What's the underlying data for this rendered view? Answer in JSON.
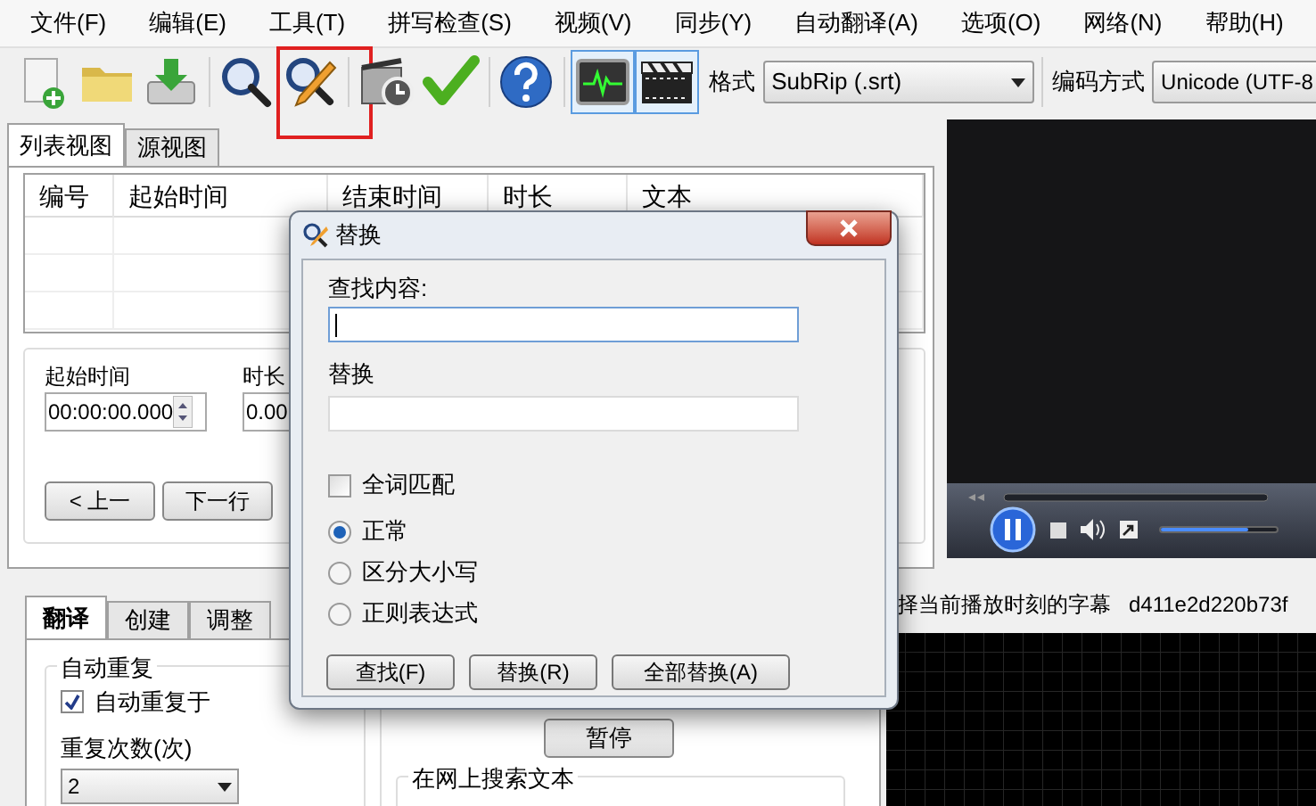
{
  "menu": [
    "文件(F)",
    "编辑(E)",
    "工具(T)",
    "拼写检查(S)",
    "视频(V)",
    "同步(Y)",
    "自动翻译(A)",
    "选项(O)",
    "网络(N)",
    "帮助(H)"
  ],
  "toolbar": {
    "buttons": [
      {
        "kind": "new",
        "selected": false,
        "highlighted": false
      },
      {
        "kind": "open",
        "selected": false,
        "highlighted": false
      },
      {
        "kind": "save",
        "selected": false,
        "highlighted": false
      },
      {
        "kind": "find",
        "selected": false,
        "highlighted": false
      },
      {
        "kind": "replace",
        "selected": false,
        "highlighted": true
      },
      {
        "kind": "timing",
        "selected": false,
        "highlighted": false
      },
      {
        "kind": "check",
        "selected": false,
        "highlighted": false
      },
      {
        "kind": "help",
        "selected": false,
        "highlighted": false
      },
      {
        "kind": "waveform",
        "selected": true,
        "highlighted": false
      },
      {
        "kind": "video",
        "selected": true,
        "highlighted": false
      }
    ],
    "format": {
      "label": "格式",
      "value": "SubRip (.srt)"
    },
    "encoding": {
      "label": "编码方式",
      "value": "Unicode (UTF-8"
    }
  },
  "view_tabs": [
    {
      "label": "列表视图",
      "selected": true
    },
    {
      "label": "源视图",
      "selected": false
    }
  ],
  "table": {
    "columns": [
      "编号",
      "起始时间",
      "结束时间",
      "时长",
      "文本"
    ]
  },
  "editor": {
    "start_label": "起始时间",
    "start_value": "00:00:00.000",
    "duration_label": "时长",
    "duration_value": "0.00",
    "buttons": [
      "< 上一",
      "下一行"
    ]
  },
  "lower_tabs": [
    {
      "label": "翻译",
      "selected": true
    },
    {
      "label": "创建",
      "selected": false
    },
    {
      "label": "调整",
      "selected": false
    }
  ],
  "auto_repeat": {
    "title": "自动重复",
    "checkbox": {
      "label": "自动重复于",
      "checked": true
    },
    "count_label": "重复次数(次)",
    "count_value": "2"
  },
  "pause_button": "暂停",
  "web_search": {
    "title": "在网上搜索文本"
  },
  "player": {
    "volume": {
      "level": 0.75
    }
  },
  "status": [
    "择当前播放时刻的字幕",
    "d411e2d220b73f"
  ],
  "dialog": {
    "title": "替换",
    "find_label": "查找内容:",
    "replace_label": "替换",
    "whole_word": {
      "label": "全词匹配",
      "checked": false
    },
    "modes": [
      {
        "label": "正常",
        "selected": true
      },
      {
        "label": "区分大小写",
        "selected": false
      },
      {
        "label": "正则表达式",
        "selected": false
      }
    ],
    "buttons": [
      "查找(F)",
      "替换(R)",
      "全部替换(A)"
    ]
  }
}
